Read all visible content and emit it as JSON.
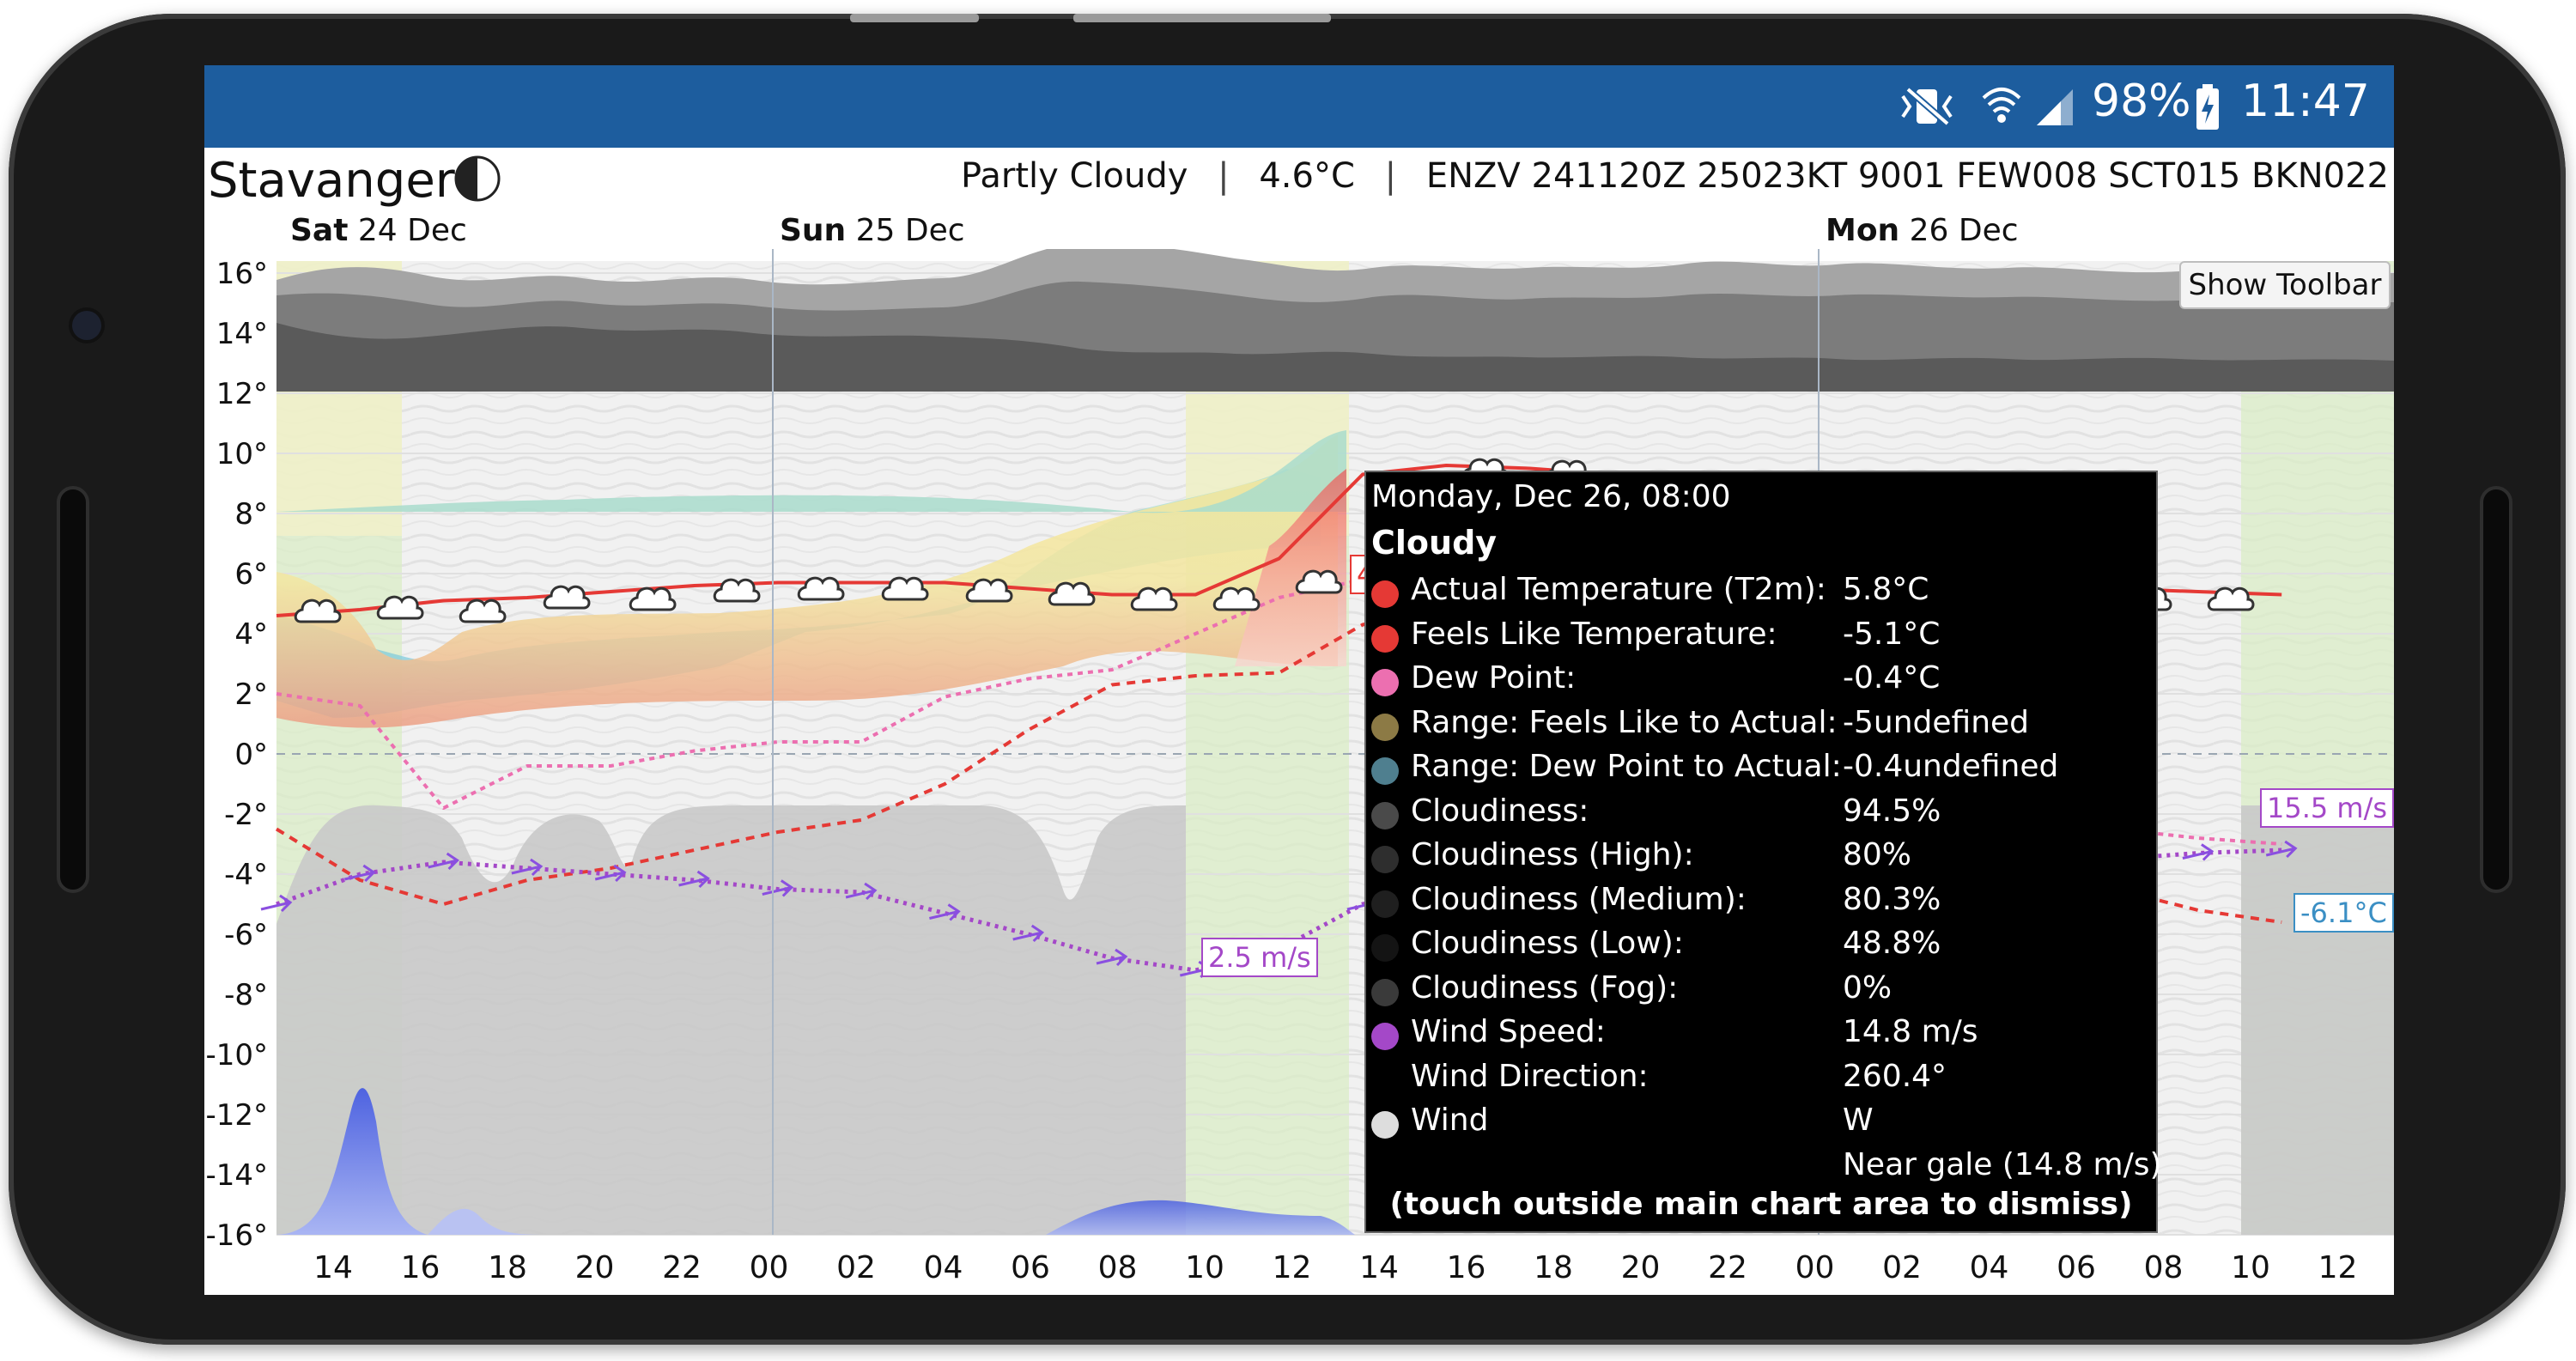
{
  "status_bar": {
    "battery": "98%",
    "time": "11:47",
    "icons": [
      "vibrate-mute-icon",
      "wifi-icon",
      "signal-icon",
      "battery-charging-icon"
    ]
  },
  "header": {
    "city": "Stavanger",
    "moon_icon": "moon-phase-icon",
    "condition": "Partly Cloudy",
    "temperature": "4.6°C",
    "metar": "ENZV 241120Z 25023KT 9001 FEW008 SCT015 BKN022",
    "separator": "|"
  },
  "days": [
    {
      "bold": "Sat",
      "rest": " 24 Dec"
    },
    {
      "bold": "Sun",
      "rest": " 25 Dec"
    },
    {
      "bold": "Mon",
      "rest": " 26 Dec"
    }
  ],
  "toolbar_button": "Show Toolbar",
  "callouts": {
    "wind_left": "2.5 m/s",
    "wind_right": "15.5 m/s",
    "dew_right": "-6.1°C",
    "temp_partial": "4"
  },
  "chart_data": {
    "type": "line",
    "ylim": [
      -16,
      16
    ],
    "y_ticks": [
      "16°",
      "14°",
      "12°",
      "10°",
      "8°",
      "6°",
      "4°",
      "2°",
      "0°",
      "-2°",
      "-4°",
      "-6°",
      "-8°",
      "-10°",
      "-12°",
      "-14°",
      "-16°"
    ],
    "x_ticks": [
      "14",
      "16",
      "18",
      "20",
      "22",
      "00",
      "02",
      "04",
      "06",
      "08",
      "10",
      "12",
      "14",
      "16",
      "18",
      "20",
      "22",
      "00",
      "02",
      "04",
      "06",
      "08",
      "10",
      "12"
    ],
    "hours": [
      0,
      2,
      4,
      6,
      8,
      10,
      12,
      14,
      16,
      18,
      20,
      22,
      24,
      26,
      28,
      30,
      32,
      34,
      36,
      38,
      40,
      42,
      44,
      46,
      48
    ],
    "series": [
      {
        "name": "Actual Temperature (T2m)",
        "color": "#e53935",
        "values": [
          4.6,
          4.8,
          5.1,
          5.2,
          5.4,
          5.6,
          5.7,
          5.7,
          5.7,
          5.5,
          5.3,
          5.3,
          6.5,
          9.3,
          9.6,
          9.5,
          9.3,
          8.5,
          7.5,
          6.5,
          5.8,
          5.6,
          5.5,
          5.4,
          5.3
        ]
      },
      {
        "name": "Feels Like Temperature",
        "color": "#e53935",
        "values": [
          -2.5,
          -4.2,
          -5.0,
          -4.2,
          -3.8,
          -3.2,
          -2.6,
          -2.2,
          -1.0,
          0.8,
          2.3,
          2.6,
          2.7,
          4.3,
          4.8,
          4.5,
          3.8,
          2.5,
          0.8,
          -1.0,
          -2.5,
          -3.5,
          -4.5,
          -5.2,
          -5.6
        ]
      },
      {
        "name": "Dew Point",
        "color": "#ec6fb0",
        "values": [
          2.0,
          1.6,
          -1.8,
          -0.4,
          -0.4,
          0.1,
          0.4,
          0.4,
          1.9,
          2.5,
          2.8,
          4.0,
          5.2,
          5.8,
          5.6,
          4.8,
          3.5,
          2.0,
          1.0,
          0.0,
          -1.0,
          -2.0,
          -2.5,
          -2.8,
          -3.0
        ]
      },
      {
        "name": "Wind Speed",
        "color": "#a448c8",
        "values": [
          -5.0,
          -4.0,
          -3.6,
          -3.8,
          -4.0,
          -4.2,
          -4.5,
          -4.6,
          -5.3,
          -6.0,
          -6.8,
          -7.2,
          -6.5,
          -5.0,
          -4.5,
          -4.2,
          -4.0,
          -3.9,
          -3.8,
          -3.7,
          -3.6,
          -3.5,
          -3.5,
          -3.3,
          -3.2
        ]
      }
    ],
    "cloud_bands": [
      {
        "name": "Cloudiness (High)",
        "color": "#9a9a9a"
      },
      {
        "name": "Cloudiness (Medium)",
        "color": "#777777"
      },
      {
        "name": "Cloudiness (Low)",
        "color": "#555555"
      }
    ],
    "fog_band": {
      "name": "Cloudiness (Fog)",
      "color": "#bdbdbd"
    },
    "precipitation": {
      "color": "#5b6de0"
    },
    "grid": true
  },
  "tooltip": {
    "title": "Monday, Dec 26, 08:00",
    "condition": "Cloudy",
    "rows": [
      {
        "label": "Actual Temperature (T2m):",
        "value": "5.8°C",
        "dot": "#e53935"
      },
      {
        "label": "Feels Like Temperature:",
        "value": "-5.1°C",
        "dot": "#e53935"
      },
      {
        "label": "Dew Point:",
        "value": "-0.4°C",
        "dot": "#ec6fb0"
      },
      {
        "label": "Range: Feels Like to Actual:",
        "value": "-5undefined",
        "dot": "#8c7a45"
      },
      {
        "label": "Range: Dew Point to Actual:",
        "value": "-0.4undefined",
        "dot": "#4f7f8f"
      },
      {
        "label": "Cloudiness:",
        "value": "94.5%",
        "dot": "#4a4a4a"
      },
      {
        "label": "Cloudiness (High):",
        "value": "80%",
        "dot": "#2e2e2e"
      },
      {
        "label": "Cloudiness (Medium):",
        "value": "80.3%",
        "dot": "#1f1f1f"
      },
      {
        "label": "Cloudiness (Low):",
        "value": "48.8%",
        "dot": "#141414"
      },
      {
        "label": "Cloudiness (Fog):",
        "value": "0%",
        "dot": "#3a3a3a"
      },
      {
        "label": "Wind Speed:",
        "value": "14.8 m/s",
        "dot": "#a448c8"
      },
      {
        "label": "Wind Direction:",
        "value": "260.4°",
        "dot": ""
      },
      {
        "label": "Wind",
        "value": "W",
        "dot": "#dddddd"
      },
      {
        "label": "",
        "value": "Near gale (14.8 m/s)",
        "dot": ""
      }
    ],
    "footer": "(touch outside main chart area to dismiss)"
  }
}
